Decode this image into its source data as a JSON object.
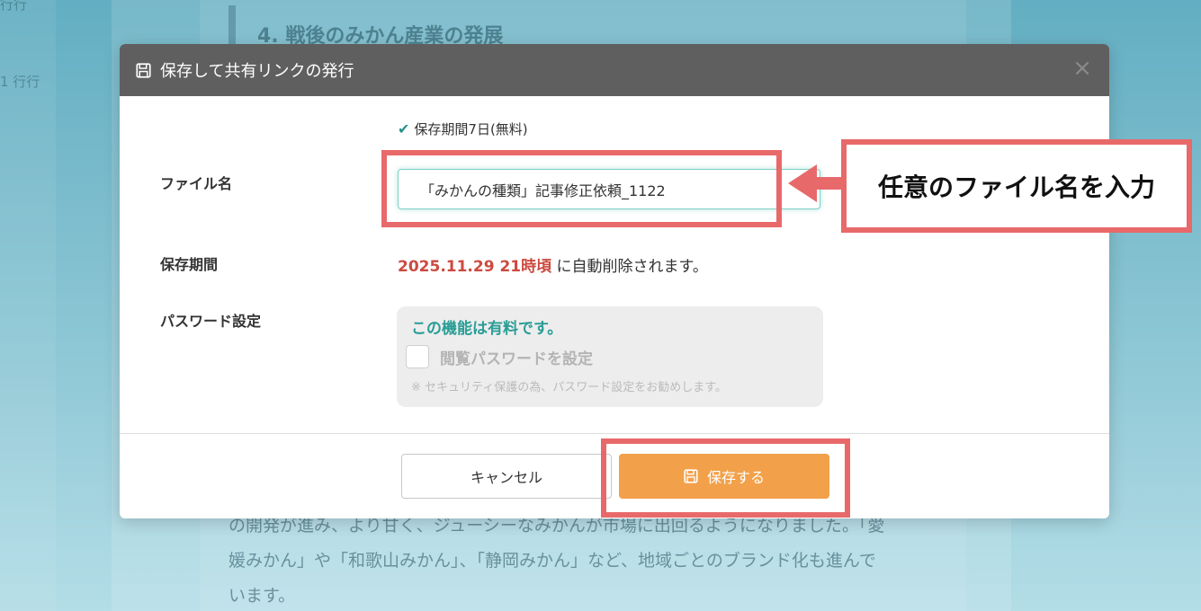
{
  "background": {
    "side_labels": [
      "行行",
      "1 行行"
    ],
    "heading": "4. 戦後のみかん産業の発展",
    "paragraph_lines": [
      "の開発が進み、より甘く、ジューシーなみかんが市場に出回るようになりました。「愛",
      "媛みかん」や「和歌山みかん」、「静岡みかん」など、地域ごとのブランド化も進んで",
      "います。"
    ]
  },
  "modal": {
    "title": "保存して共有リンクの発行",
    "close_icon": "×",
    "free_note": "保存期間7日(無料)",
    "file_name_label": "ファイル名",
    "file_name_value": "「みかんの種類」記事修正依頼_1122",
    "retention_label": "保存期間",
    "retention_date": "2025.11.29 21時頃",
    "retention_suffix": "に自動削除されます。",
    "password_label": "パスワード設定",
    "password_paid": "この機能は有料です。",
    "password_checkbox_label": "閲覧パスワードを設定",
    "password_note": "※ セキュリティ保護の為、パスワード設定をお勧めします。",
    "cancel_label": "キャンセル",
    "save_label": "保存する"
  },
  "annotation": {
    "callout_text": "任意のファイル名を入力"
  },
  "colors": {
    "accent_teal": "#2a9d96",
    "save_orange": "#f2a14a",
    "date_red": "#cc4a40",
    "annotation_red": "#e8696a"
  },
  "icons": {
    "title_icon": "floppy-disk-icon",
    "check_icon": "checkmark-icon",
    "save_icon": "floppy-disk-icon"
  }
}
